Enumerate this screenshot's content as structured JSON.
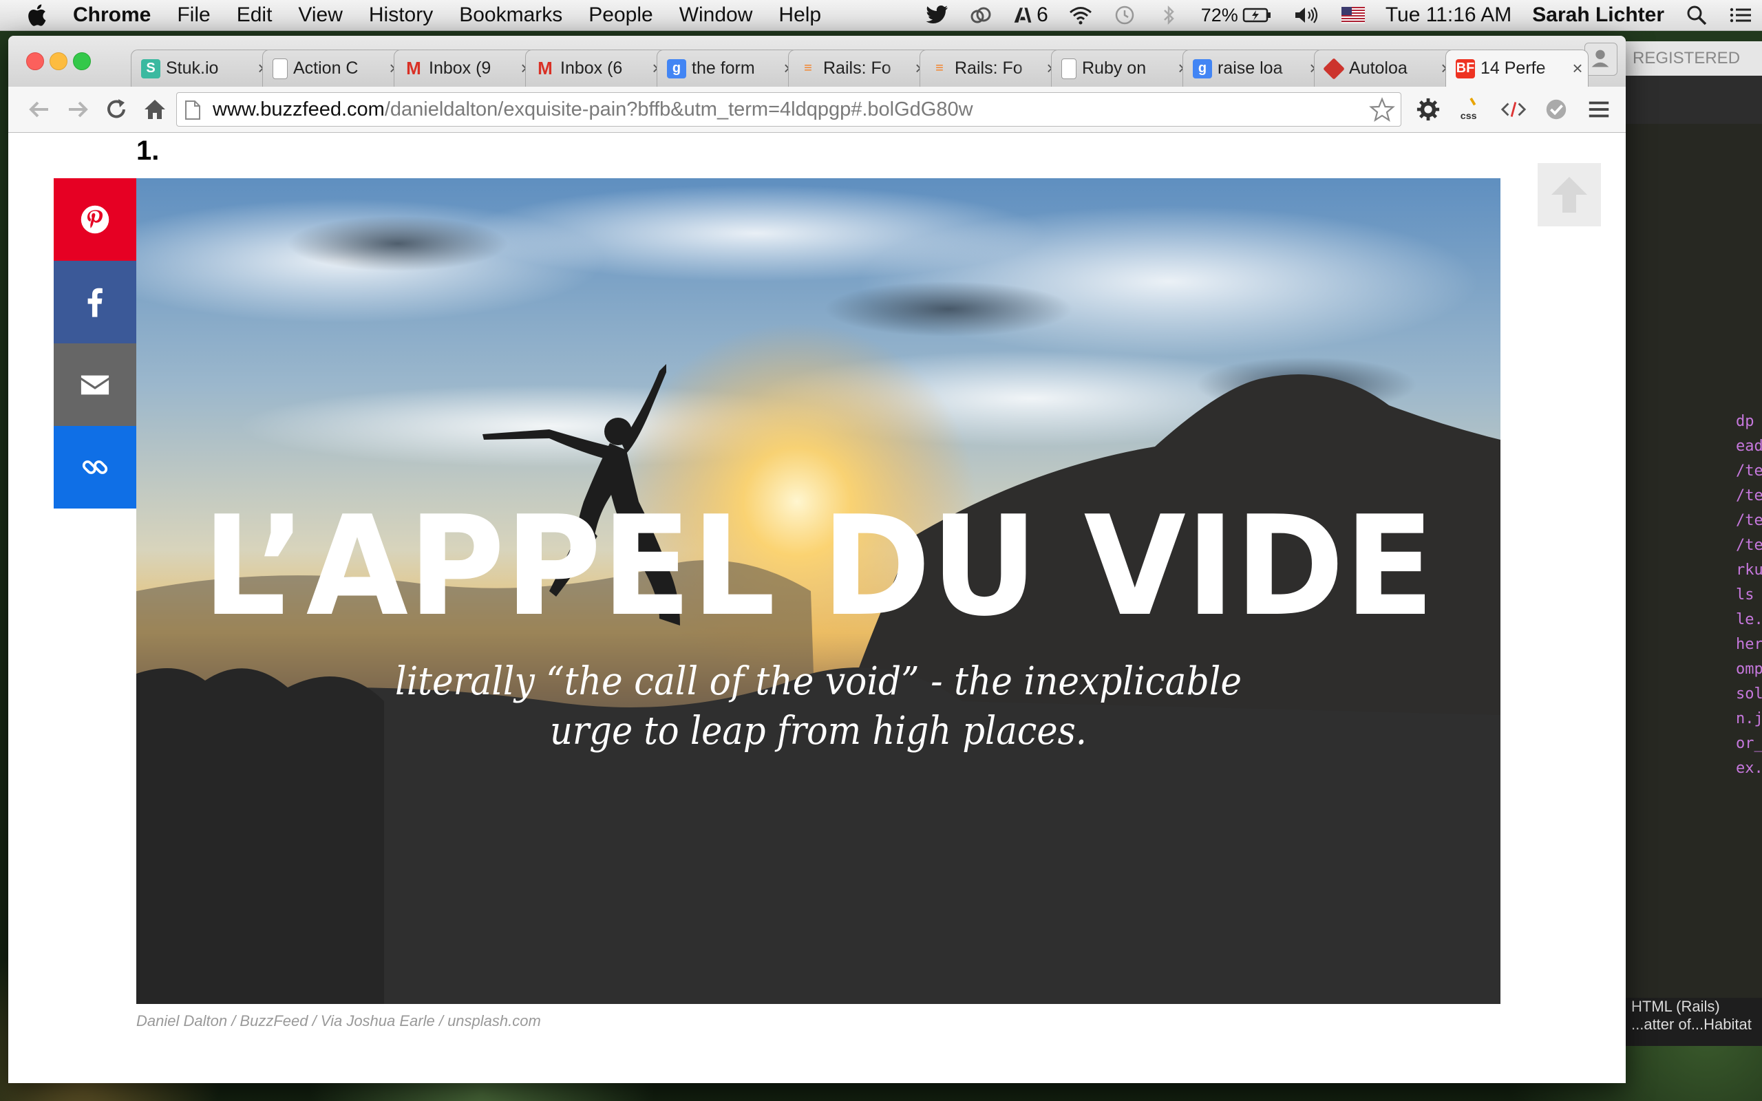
{
  "menubar": {
    "app_name": "Chrome",
    "menus": [
      "File",
      "Edit",
      "View",
      "History",
      "Bookmarks",
      "People",
      "Window",
      "Help"
    ],
    "adobe_count": "6",
    "battery": "72%",
    "clock": "Tue 11:16 AM",
    "user": "Sarah Lichter"
  },
  "browser": {
    "tabs": [
      {
        "title": "Stuk.io",
        "favicon": "S",
        "favicon_color": "#3bb9a0"
      },
      {
        "title": "Action C",
        "favicon": "page",
        "favicon_color": "#ffffff"
      },
      {
        "title": "Inbox (9",
        "favicon": "M",
        "favicon_color": "#ffffff"
      },
      {
        "title": "Inbox (6",
        "favicon": "M",
        "favicon_color": "#ffffff"
      },
      {
        "title": "the form",
        "favicon": "g",
        "favicon_color": "#4285f4"
      },
      {
        "title": "Rails: Fo",
        "favicon": "SO",
        "favicon_color": "#f48024"
      },
      {
        "title": "Rails: Fo",
        "favicon": "SO",
        "favicon_color": "#f48024"
      },
      {
        "title": "Ruby on",
        "favicon": "page",
        "favicon_color": "#ffffff"
      },
      {
        "title": "raise loa",
        "favicon": "g",
        "favicon_color": "#4285f4"
      },
      {
        "title": "Autoloa",
        "favicon": "ruby",
        "favicon_color": "#cc342d"
      },
      {
        "title": "14 Perfe",
        "favicon": "BF",
        "favicon_color": "#ee3322",
        "active": true
      }
    ],
    "url_host": "www.buzzfeed.com",
    "url_path": "/danieldalton/exquisite-pain?bffb&utm_term=4ldqpgp#.bolGdG80w",
    "extensions": [
      "gear-icon",
      "css-icon",
      "code-icon",
      "check-icon"
    ]
  },
  "article": {
    "item_number": "1.",
    "hero_title": "L’APPEL DU VIDE",
    "hero_subtitle_line1": "literally “the call of the void” - the inexplicable",
    "hero_subtitle_line2": "urge to leap from high places.",
    "caption": "Daniel Dalton / BuzzFeed / Via Joshua Earle / unsplash.com",
    "share_buttons": [
      {
        "name": "pinterest",
        "color": "#e60023"
      },
      {
        "name": "facebook",
        "color": "#3b5998"
      },
      {
        "name": "email",
        "color": "#666666"
      },
      {
        "name": "link",
        "color": "#0f6fe6"
      }
    ]
  },
  "background_app": {
    "top_label": "REGISTERED",
    "status_line1": "HTML (Rails)",
    "status_line2": "...atter of...Habitat",
    "code_fragments": [
      "dp",
      "ead",
      "/te",
      "/te",
      "/te",
      "/te",
      "rku",
      "ls",
      "le.",
      "her",
      "omp",
      "sol",
      "n.j",
      "or_",
      "ex."
    ]
  }
}
